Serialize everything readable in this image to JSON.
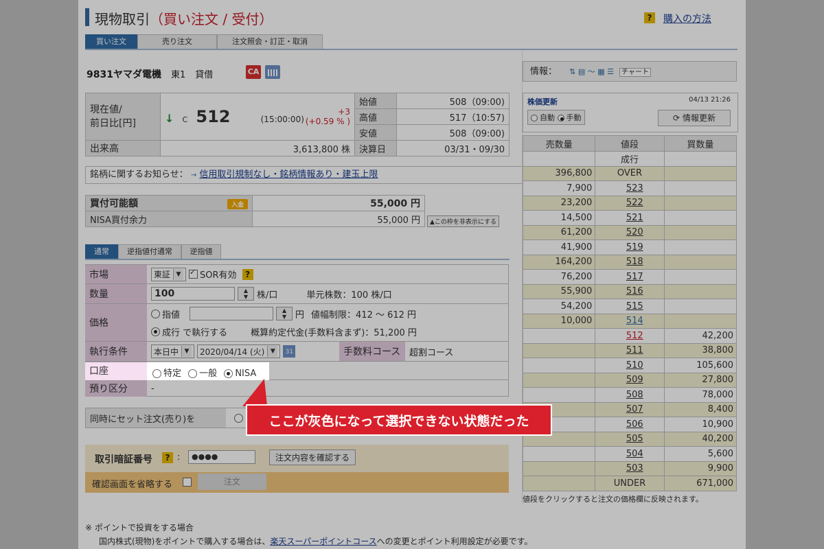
{
  "header": {
    "title_main": "現物取引",
    "title_sub": "（買い注文 / 受付）",
    "help_icon": "?",
    "help_link": "購入の方法"
  },
  "tabs": [
    "買い注文",
    "売り注文",
    "注文照会・訂正・取消"
  ],
  "stock": {
    "name": "9831ヤマダ電機",
    "market": "東1",
    "type": "貸借",
    "ca_badge": "CA"
  },
  "price_panel": {
    "current_label": "現在値/",
    "prev_label": "前日比[円]",
    "arrow": "↓",
    "c_mark": "C",
    "price": "512",
    "time": "(15:00:00)",
    "change": "+3",
    "change_pct": "(+0.59 % )",
    "open_label": "始値",
    "open": "508（09:00)",
    "high_label": "高値",
    "high": "517（10:57)",
    "low_label": "安値",
    "low": "508（09:00)",
    "volume_label": "出来高",
    "volume": "3,613,800 株",
    "settle_label": "決算日",
    "settle": "03/31・09/30"
  },
  "notice": {
    "label": "銘柄に関するお知らせ：",
    "arrow": "→",
    "link": "信用取引規制なし・銘柄情報あり・建玉上限"
  },
  "buying_power": {
    "label": "買付可能額",
    "deposit_btn": "入金",
    "value": "55,000 円",
    "nisa_label": "NISA買付余力",
    "nisa_value": "55,000 円",
    "hide_btn": "▲この枠を非表示にする"
  },
  "order_tabs": [
    "通常",
    "逆指値付通常",
    "逆指値"
  ],
  "form": {
    "market_label": "市場",
    "market_value": "東証",
    "sor_label": "SOR有効",
    "qty_label": "数量",
    "qty_value": "100",
    "qty_unit": "株/口",
    "unit_info": "単元株数：100 株/口",
    "price_label": "価格",
    "limit_label": "指値",
    "yen": "円",
    "price_range": "値幅制限：412 〜 612 円",
    "market_order": "成行 で執行する",
    "estimate": "概算約定代金(手数料含まず)：51,200 円",
    "cond_label": "執行条件",
    "cond_value": "本日中",
    "date_value": "2020/04/14 (火)",
    "cal_day": "31",
    "fee_label": "手数料コース",
    "fee_value": "超割コース",
    "account_label": "口座",
    "acc_tokutei": "特定",
    "acc_ippan": "一般",
    "acc_nisa": "NISA",
    "deposit_label": "預り区分",
    "deposit_value": "-"
  },
  "set_order_label": "同時にセット注文(売り)を",
  "callout": "ここが灰色になって選択できない状態だった",
  "pin": {
    "label": "取引暗証番号",
    "value": "●●●●",
    "confirm_btn": "注文内容を確認する",
    "skip_label": "確認画面を省略する",
    "order_btn": "注文"
  },
  "footer": {
    "note1": "※ ポイントで投資をする場合",
    "note2_a": "国内株式(現物)をポイントで購入する場合は、",
    "note2_link": "楽天スーパーポイントコース",
    "note2_b": "への変更とポイント利用設定が必要です。"
  },
  "info": {
    "label": "情報：",
    "chart": "チャート"
  },
  "update": {
    "label": "株価更新",
    "datetime": "04/13 21:26",
    "auto": "自動",
    "manual": "手動",
    "refresh": "情報更新"
  },
  "board": {
    "headers": [
      "売数量",
      "値段",
      "買数量"
    ],
    "market_row": "成行",
    "over_qty": "396,800",
    "over": "OVER",
    "rows": [
      {
        "sell": "7,900",
        "price": "523",
        "buy": ""
      },
      {
        "sell": "23,200",
        "price": "522",
        "buy": ""
      },
      {
        "sell": "14,500",
        "price": "521",
        "buy": ""
      },
      {
        "sell": "61,200",
        "price": "520",
        "buy": ""
      },
      {
        "sell": "41,900",
        "price": "519",
        "buy": ""
      },
      {
        "sell": "164,200",
        "price": "518",
        "buy": ""
      },
      {
        "sell": "76,200",
        "price": "517",
        "buy": ""
      },
      {
        "sell": "55,900",
        "price": "516",
        "buy": ""
      },
      {
        "sell": "54,200",
        "price": "515",
        "buy": ""
      },
      {
        "sell": "10,000",
        "price": "514",
        "buy": ""
      },
      {
        "sell": "",
        "price": "512",
        "buy": "42,200"
      },
      {
        "sell": "",
        "price": "511",
        "buy": "38,800"
      },
      {
        "sell": "",
        "price": "510",
        "buy": "105,600"
      },
      {
        "sell": "",
        "price": "509",
        "buy": "27,800"
      },
      {
        "sell": "",
        "price": "508",
        "buy": "78,000"
      },
      {
        "sell": "",
        "price": "507",
        "buy": "8,400"
      },
      {
        "sell": "",
        "price": "506",
        "buy": "10,900"
      },
      {
        "sell": "",
        "price": "505",
        "buy": "40,200"
      },
      {
        "sell": "",
        "price": "504",
        "buy": "5,600"
      },
      {
        "sell": "",
        "price": "503",
        "buy": "9,900"
      }
    ],
    "under": "UNDER",
    "under_qty": "671,000",
    "note": "値段をクリックすると注文の価格欄に反映されます。"
  },
  "colors": {
    "accent_blue": "#2f6aa3",
    "red": "#c8202b",
    "board_alt": "#f3efd2"
  }
}
